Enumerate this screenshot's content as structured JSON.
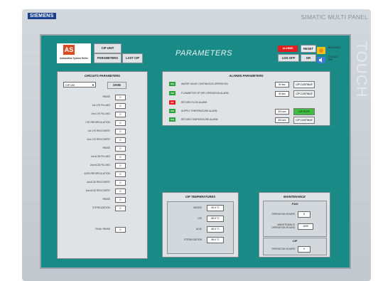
{
  "device": {
    "brand": "SIEMENS",
    "model": "SIMATIC MULTI PANEL",
    "touch": "TOUCH"
  },
  "header": {
    "logo_mark": "AS",
    "logo_text": "Automation System Heller",
    "cip_unit": "CIP UNIT",
    "parameters": "PARAMETERS",
    "last_cip": "LAST CIP",
    "page_title": "PARAMETERS",
    "alarm": "ALARMS",
    "reset": "RESET",
    "logoff": "LOG OFF",
    "gr": "GR",
    "date": "8/13/2013",
    "time": "7:02:43 PM"
  },
  "circuits": {
    "title": "CIRCUITS PARAMETERS",
    "selected": "CIP 100",
    "save": "SAVE",
    "rows": [
      {
        "label": "RINSE",
        "value": "0"
      },
      {
        "label": "1st LYE FILLING",
        "value": "0"
      },
      {
        "label": "2nd LYE FILLING",
        "value": "0"
      },
      {
        "label": "LYE RECIRCULATION",
        "value": "0"
      },
      {
        "label": "1st LYE RECOVERY",
        "value": "0"
      },
      {
        "label": "2nd LYE RECOVERY",
        "value": "0"
      },
      {
        "label": "RINSE",
        "value": "0"
      },
      {
        "label": "1st ACID FILLING",
        "value": "0"
      },
      {
        "label": "2nd ACID FILLING",
        "value": "0"
      },
      {
        "label": "ACID RECIRCULATION",
        "value": "0"
      },
      {
        "label": "1st ACID RECOVERY",
        "value": "0"
      },
      {
        "label": "2nd ACID RECOVERY",
        "value": "0"
      },
      {
        "label": "RINSE",
        "value": "0"
      },
      {
        "label": "STERILIZATION",
        "value": "0"
      }
    ],
    "final_rinse_label": "FINAL RINSE",
    "final_rinse_value": "0"
  },
  "alarms": {
    "title": "ALARMS PARAMETERS",
    "rows": [
      {
        "status": "YES",
        "status_color": "#2aa33b",
        "label": "WATER VALVE CONTINUOUS OPERATION",
        "time": "60 sec",
        "action": "CIP CONTINUE",
        "action_color": "#f0f2f3"
      },
      {
        "status": "YES",
        "status_color": "#2aa33b",
        "label": "FLOWMETER OF DRY OPERATION ALARM",
        "time": "60 sec",
        "action": "CIP CONTINUE",
        "action_color": "#f0f2f3"
      },
      {
        "status": "NO",
        "status_color": "#e41e1e",
        "label": "RETURN FLOW ALARM",
        "time": "",
        "action": "",
        "action_color": ""
      },
      {
        "status": "YES",
        "status_color": "#2aa33b",
        "label": "SUPPLY TEMPERATURE ALARM",
        "time": "300 sec",
        "action": "CIP STOP",
        "action_color": "#3fbd3f"
      },
      {
        "status": "YES",
        "status_color": "#2aa33b",
        "label": "RETURN TEMPERATURE ALARM",
        "time": "300 sec",
        "action": "CIP CONTINUE",
        "action_color": "#f0f2f3"
      }
    ]
  },
  "temps": {
    "title": "CIP TEMPERATURES",
    "rows": [
      {
        "label": "WATER",
        "value": "50.0 °C"
      },
      {
        "label": "LYE",
        "value": "80.0 °C"
      },
      {
        "label": "ACID",
        "value": "60.0 °C"
      },
      {
        "label": "STERILIZATION",
        "value": "95.0 °C"
      }
    ]
  },
  "maintenance": {
    "title": "MAINTENANCE",
    "pump_title": "P100",
    "op_hours_label": "OPERATION HOURS",
    "op_hours_value": "5",
    "maint_label": "MAINTENANCE OPERATION HOURS",
    "maint_value": "1000",
    "cip_title": "CIP",
    "cip_hours_label": "OPERATION HOURS",
    "cip_hours_value": "0"
  }
}
